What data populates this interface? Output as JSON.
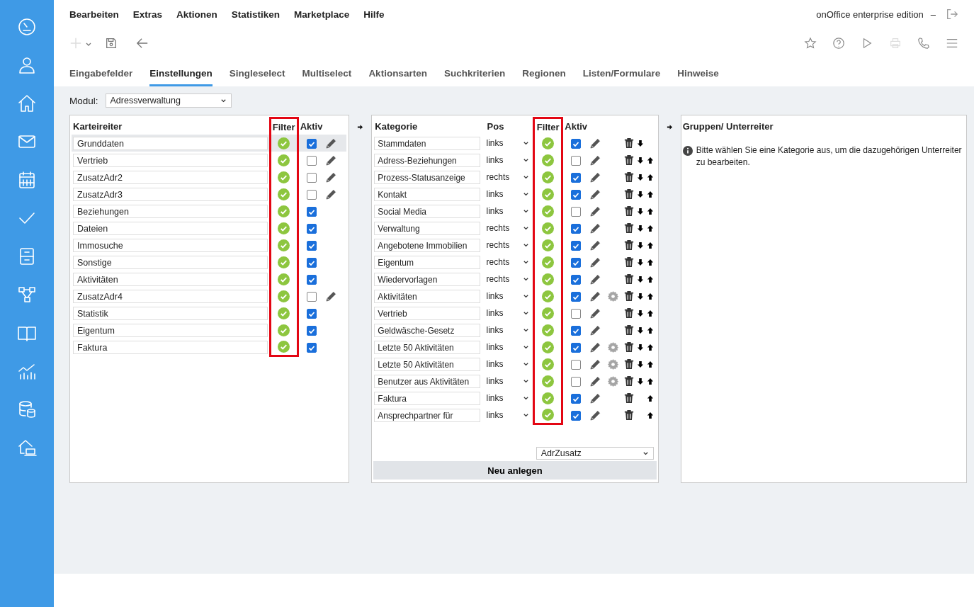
{
  "menu": [
    "Bearbeiten",
    "Extras",
    "Aktionen",
    "Statistiken",
    "Marketplace",
    "Hilfe"
  ],
  "app_title": "onOffice enterprise edition",
  "app_separator": "–",
  "tabs": [
    {
      "label": "Eingabefelder",
      "selected": false
    },
    {
      "label": "Einstellungen",
      "selected": true
    },
    {
      "label": "Singleselect",
      "selected": false
    },
    {
      "label": "Multiselect",
      "selected": false
    },
    {
      "label": "Aktionsarten",
      "selected": false
    },
    {
      "label": "Suchkriterien",
      "selected": false
    },
    {
      "label": "Regionen",
      "selected": false
    },
    {
      "label": "Listen/Formulare",
      "selected": false
    },
    {
      "label": "Hinweise",
      "selected": false
    }
  ],
  "modul": {
    "label": "Modul:",
    "value": "Adressverwaltung"
  },
  "tabs_panel": {
    "headers": {
      "name": "Karteireiter",
      "filter": "Filter",
      "active": "Aktiv"
    },
    "rows": [
      {
        "name": "Grunddaten",
        "filter": true,
        "active": true,
        "editable": true,
        "selected": true
      },
      {
        "name": "Vertrieb",
        "filter": true,
        "active": false,
        "editable": true,
        "selected": false
      },
      {
        "name": "ZusatzAdr2",
        "filter": true,
        "active": false,
        "editable": true,
        "selected": false
      },
      {
        "name": "ZusatzAdr3",
        "filter": true,
        "active": false,
        "editable": true,
        "selected": false
      },
      {
        "name": "Beziehungen",
        "filter": true,
        "active": true,
        "editable": false,
        "selected": false
      },
      {
        "name": "Dateien",
        "filter": true,
        "active": true,
        "editable": false,
        "selected": false
      },
      {
        "name": "Immosuche",
        "filter": true,
        "active": true,
        "editable": false,
        "selected": false
      },
      {
        "name": "Sonstige",
        "filter": true,
        "active": true,
        "editable": false,
        "selected": false
      },
      {
        "name": "Aktivitäten",
        "filter": true,
        "active": true,
        "editable": false,
        "selected": false
      },
      {
        "name": "ZusatzAdr4",
        "filter": true,
        "active": false,
        "editable": true,
        "selected": false
      },
      {
        "name": "Statistik",
        "filter": true,
        "active": true,
        "editable": false,
        "selected": false
      },
      {
        "name": "Eigentum",
        "filter": true,
        "active": true,
        "editable": false,
        "selected": false
      },
      {
        "name": "Faktura",
        "filter": true,
        "active": true,
        "editable": false,
        "selected": false
      }
    ]
  },
  "category_panel": {
    "headers": {
      "name": "Kategorie",
      "pos": "Pos",
      "filter": "Filter",
      "active": "Aktiv"
    },
    "rows": [
      {
        "name": "Stammdaten",
        "pos": "links",
        "filter": true,
        "active": true,
        "settings": false,
        "down": true,
        "up": false
      },
      {
        "name": "Adress-Beziehungen",
        "pos": "links",
        "filter": true,
        "active": false,
        "settings": false,
        "down": true,
        "up": true
      },
      {
        "name": "Prozess-Statusanzeige",
        "pos": "rechts",
        "filter": true,
        "active": true,
        "settings": false,
        "down": true,
        "up": true
      },
      {
        "name": "Kontakt",
        "pos": "links",
        "filter": true,
        "active": true,
        "settings": false,
        "down": true,
        "up": true
      },
      {
        "name": "Social Media",
        "pos": "links",
        "filter": true,
        "active": false,
        "settings": false,
        "down": true,
        "up": true
      },
      {
        "name": "Verwaltung",
        "pos": "rechts",
        "filter": true,
        "active": true,
        "settings": false,
        "down": true,
        "up": true
      },
      {
        "name": "Angebotene Immobilien",
        "pos": "rechts",
        "filter": true,
        "active": true,
        "settings": false,
        "down": true,
        "up": true
      },
      {
        "name": "Eigentum",
        "pos": "rechts",
        "filter": true,
        "active": true,
        "settings": false,
        "down": true,
        "up": true
      },
      {
        "name": "Wiedervorlagen",
        "pos": "rechts",
        "filter": true,
        "active": true,
        "settings": false,
        "down": true,
        "up": true
      },
      {
        "name": "Aktivitäten",
        "pos": "links",
        "filter": true,
        "active": true,
        "settings": true,
        "down": true,
        "up": true
      },
      {
        "name": "Vertrieb",
        "pos": "links",
        "filter": true,
        "active": false,
        "settings": false,
        "down": true,
        "up": true
      },
      {
        "name": "Geldwäsche-Gesetz",
        "pos": "links",
        "filter": true,
        "active": true,
        "settings": false,
        "down": true,
        "up": true
      },
      {
        "name": "Letzte 50 Aktivitäten",
        "pos": "links",
        "filter": true,
        "active": true,
        "settings": true,
        "down": true,
        "up": true
      },
      {
        "name": "Letzte 50 Aktivitäten",
        "pos": "links",
        "filter": true,
        "active": false,
        "settings": true,
        "down": true,
        "up": true
      },
      {
        "name": "Benutzer aus Aktivitäten",
        "pos": "links",
        "filter": true,
        "active": false,
        "settings": true,
        "down": true,
        "up": true
      },
      {
        "name": "Faktura",
        "pos": "links",
        "filter": true,
        "active": true,
        "settings": false,
        "down": false,
        "up": true
      },
      {
        "name": "Ansprechpartner für",
        "pos": "links",
        "filter": true,
        "active": true,
        "settings": false,
        "down": false,
        "up": true
      }
    ],
    "new_select": "AdrZusatz",
    "new_button": "Neu anlegen"
  },
  "groups_panel": {
    "title": "Gruppen/ Unterreiter",
    "info": "Bitte wählen Sie eine Kategorie aus, um die dazugehörigen Unterreiter zu bearbeiten."
  }
}
